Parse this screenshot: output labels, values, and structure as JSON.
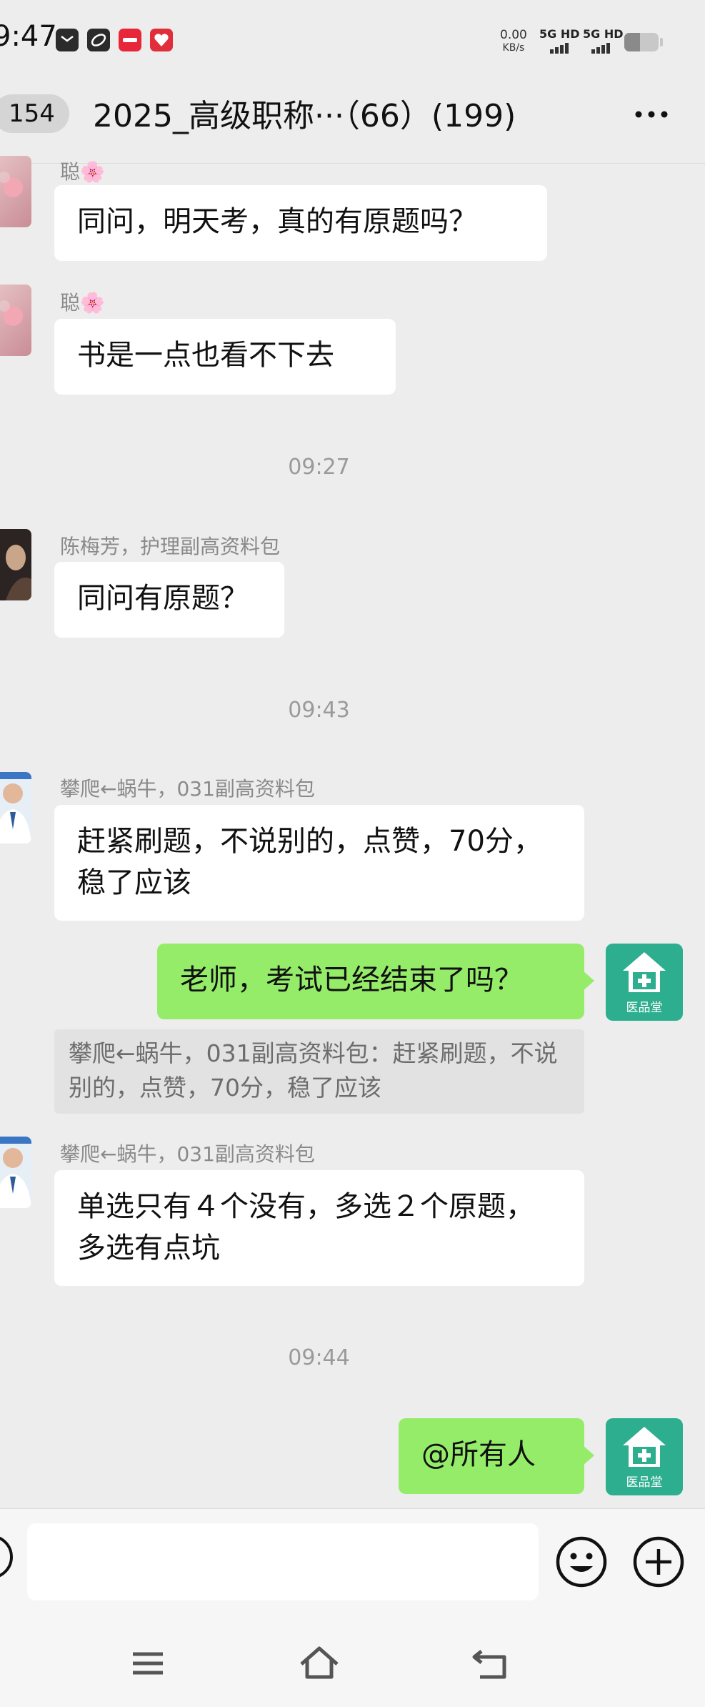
{
  "status_bar": {
    "time": "9:47",
    "app_icons": [
      "mail-icon",
      "sport-app-icon",
      "taobao-app-icon",
      "pinduoduo-app-icon"
    ],
    "net_speed_value": "0.00",
    "net_speed_unit": "KB/s",
    "sim1": "5G HD",
    "sim2": "5G HD",
    "battery_level": 0.45
  },
  "header": {
    "unread_count": "154",
    "title": "2025_高级职称···（66）(199)",
    "more_icon": "more-icon"
  },
  "messages": [
    {
      "sender": "聪🌸",
      "text": "同问，明天考，真的有原题吗？"
    },
    {
      "sender": "聪🌸",
      "text": "书是一点也看不下去"
    },
    {
      "timestamp": "09:27"
    },
    {
      "sender": "陈梅芳，护理副高资料包",
      "text": "同问有原题？"
    },
    {
      "timestamp": "09:43"
    },
    {
      "sender": "攀爬←蜗牛，031副高资料包",
      "text": "赶紧刷题，不说别的，点赞，70分，稳了应该"
    },
    {
      "self": true,
      "text": "老师，考试已经结束了吗？",
      "quote": "攀爬←蜗牛，031副高资料包：赶紧刷题，不说别的，点赞，70分，稳了应该"
    },
    {
      "sender": "攀爬←蜗牛，031副高资料包",
      "text": "单选只有４个没有，多选２个原题，多选有点坑"
    },
    {
      "timestamp": "09:44"
    },
    {
      "self": true,
      "text": "@所有人"
    }
  ],
  "self_avatar_label": "医品堂",
  "input_bar": {
    "placeholder": "",
    "voice_icon": "voice-icon",
    "emoji_icon": "emoji-icon",
    "plus_icon": "plus-icon"
  },
  "nav_bar": [
    "menu-icon",
    "home-icon",
    "back-icon"
  ],
  "colors": {
    "background": "#ededed",
    "self_bubble": "#95ec69",
    "other_bubble": "#ffffff",
    "self_avatar": "#2dae8f"
  }
}
